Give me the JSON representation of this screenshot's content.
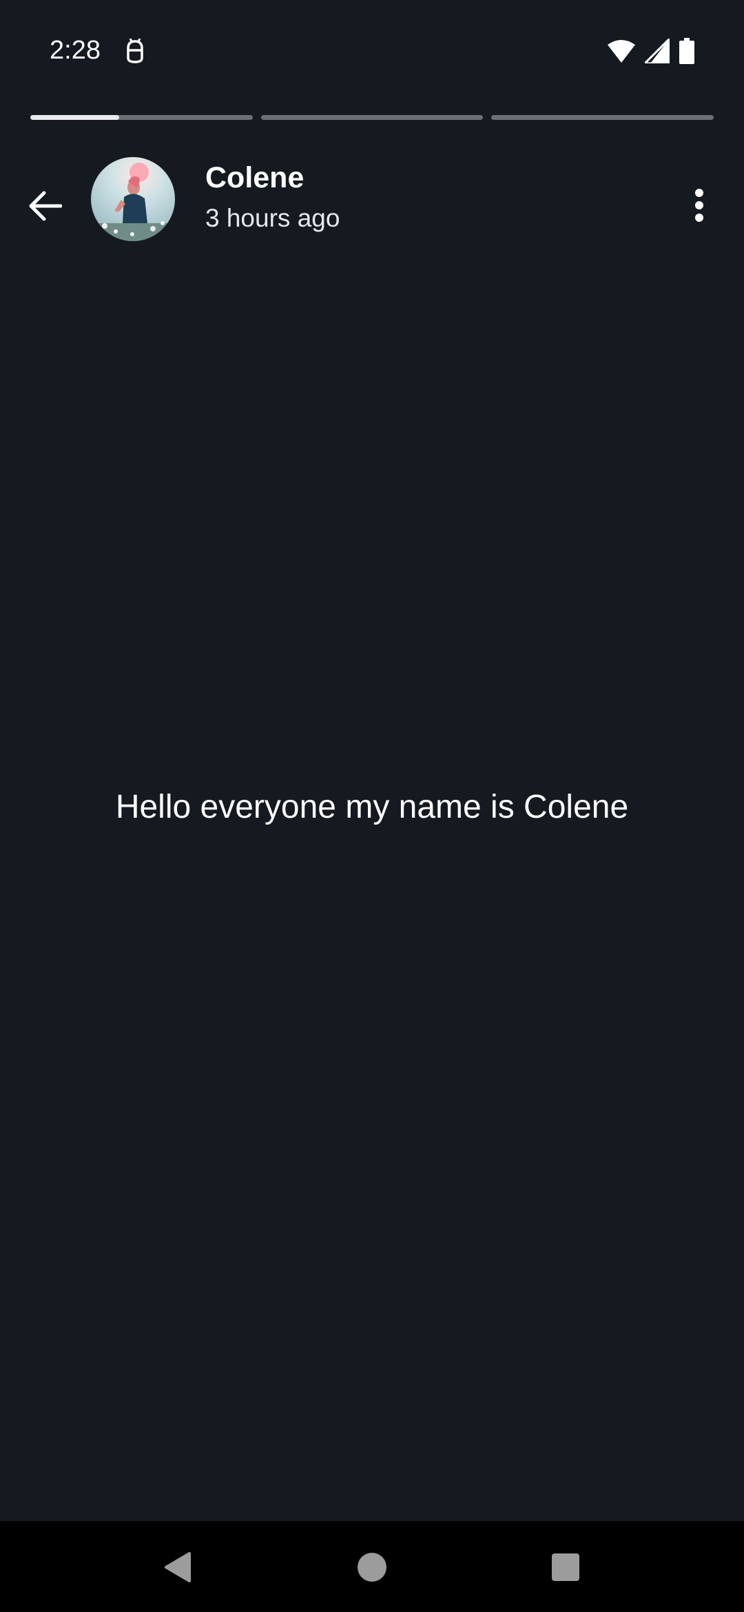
{
  "status_bar": {
    "time": "2:28",
    "icons": [
      "app-notification-icon",
      "wifi-icon",
      "signal-icon",
      "battery-icon"
    ]
  },
  "story": {
    "progress": [
      0.4,
      0,
      0
    ],
    "user_name": "Colene",
    "post_time": "3 hours ago",
    "text": "Hello everyone my name is Colene"
  },
  "nav": {
    "icons": [
      "back-nav-icon",
      "home-nav-icon",
      "recents-nav-icon"
    ]
  },
  "colors": {
    "background": "#151a21",
    "progress_track": "#6b7075",
    "progress_fill": "#e9ebec",
    "nav_bar": "#000000"
  }
}
